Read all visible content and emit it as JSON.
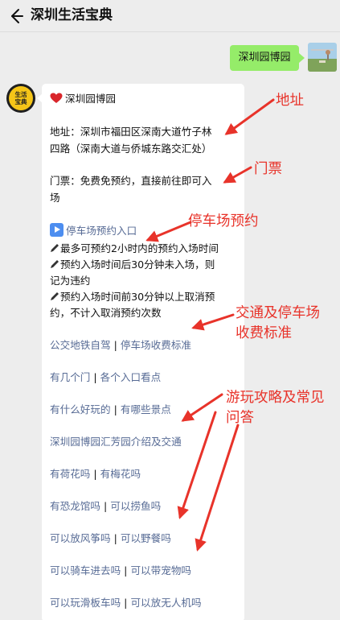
{
  "header": {
    "title": "深圳生活宝典"
  },
  "outgoing": {
    "message": "深圳园博园"
  },
  "avatar": {
    "line1": "生活",
    "line2": "宝典"
  },
  "card": {
    "title": "深圳园博园",
    "address_line1": "地址：深圳市福田区深南大道竹子林",
    "address_line2": "四路（深南大道与侨城东路交汇处）",
    "ticket_line1": "门票：免费免预约，直接前往即可入",
    "ticket_line2": "场",
    "parking_link": "停车场预约入口",
    "rule1": "最多可预约2小时内的预约入场时间",
    "rule2_line1": "预约入场时间后30分钟未入场，则",
    "rule2_line2": "记为违约",
    "rule3_line1": "预约入场时间前30分钟以上取消预",
    "rule3_line2": "约，不计入取消预约次数",
    "links": [
      {
        "left": "公交地铁自驾",
        "right": "停车场收费标准"
      },
      {
        "left": "有几个门",
        "right": "各个入口看点"
      },
      {
        "left": "有什么好玩的",
        "right": "有哪些景点"
      },
      {
        "single": "深圳园博园汇芳园介绍及交通"
      },
      {
        "left": "有荷花吗",
        "right": "有梅花吗"
      },
      {
        "left": "有恐龙馆吗",
        "right": "可以捞鱼吗"
      },
      {
        "left": "可以放风筝吗",
        "right": "可以野餐吗"
      },
      {
        "left": "可以骑车进去吗",
        "right": "可以带宠物吗"
      },
      {
        "left": "可以玩滑板车吗",
        "right": "可以放无人机吗"
      }
    ],
    "separator": "|"
  },
  "annotations": {
    "address": "地址",
    "ticket": "门票",
    "parking": "停车场预约",
    "traffic_line1": "交通及停车场",
    "traffic_line2": "收费标准",
    "guide_line1": "游玩攻略及常见",
    "guide_line2": "问答"
  },
  "colors": {
    "link": "#576b95",
    "annotation": "#e8332a",
    "bubble": "#95ec69"
  }
}
